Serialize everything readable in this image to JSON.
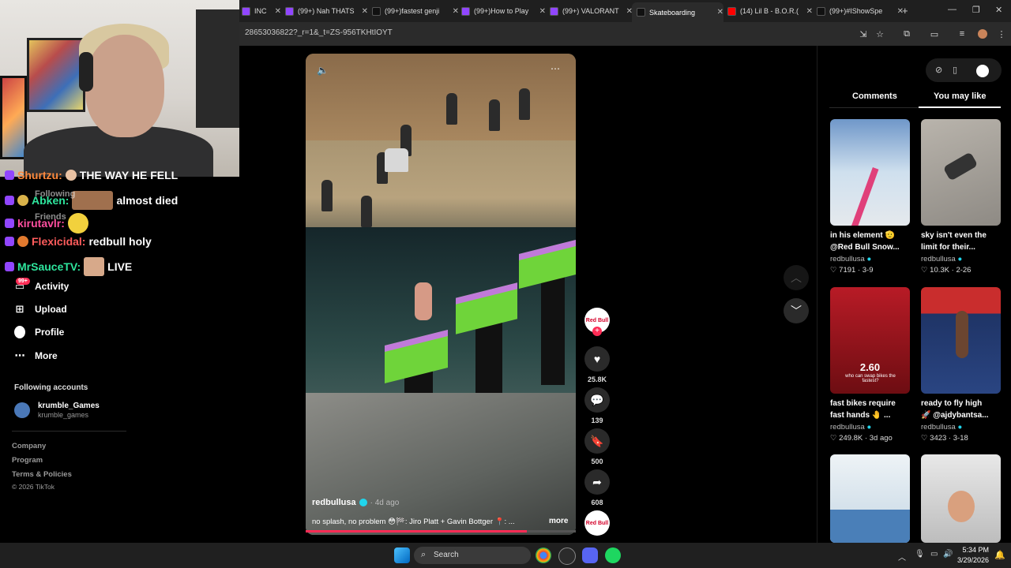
{
  "browser": {
    "tabs": [
      {
        "label": "INC",
        "icon": "twitch-icon",
        "color": "#9146ff"
      },
      {
        "label": "(99+) Nah THATS",
        "icon": "twitch-icon",
        "color": "#9146ff"
      },
      {
        "label": "(99+)fastest genji",
        "icon": "tiktok-icon",
        "color": "#000000"
      },
      {
        "label": "(99+)How to Play",
        "icon": "twitch-icon",
        "color": "#9146ff"
      },
      {
        "label": "(99+) VALORANT",
        "icon": "twitch-icon",
        "color": "#9146ff"
      },
      {
        "label": "Skateboarding",
        "icon": "tiktok-icon",
        "color": "#000000"
      },
      {
        "label": "(14) Lil B - B.O.R.(",
        "icon": "youtube-icon",
        "color": "#ff0000"
      },
      {
        "label": "(99+)#IShowSpe",
        "icon": "tiktok-icon",
        "color": "#000000"
      }
    ],
    "url": "28653036822?_r=1&_t=ZS-956TKHtIOYT"
  },
  "chat": [
    {
      "user": "Shurtzu:",
      "message": "THE WAY HE FELL",
      "color": "#ff8a3d"
    },
    {
      "user": "Abken:",
      "message": "almost died",
      "color": "#2ee59d"
    },
    {
      "user": "kirutavlr:",
      "message": "",
      "color": "#ff4fa0"
    },
    {
      "user": "Flexicidal:",
      "message": "redbull holy",
      "color": "#ff5c5c"
    },
    {
      "user": "MrSauceTV:",
      "message": "LIVE",
      "color": "#2ee59d"
    }
  ],
  "sidebar": {
    "hidden_items": [
      "Following",
      "Friends"
    ],
    "activity_badge": "99+",
    "nav": [
      {
        "label": "Activity",
        "icon": "inbox-icon"
      },
      {
        "label": "Upload",
        "icon": "plus-square-icon"
      },
      {
        "label": "Profile",
        "icon": "avatar-icon"
      },
      {
        "label": "More",
        "icon": "ellipsis-icon"
      }
    ],
    "following_header": "Following accounts",
    "following": [
      {
        "name": "krumble_Games",
        "handle": "krumble_games"
      }
    ],
    "footer": [
      "Company",
      "Program",
      "Terms & Policies",
      "© 2026 TikTok"
    ]
  },
  "video": {
    "author": "redbullusa",
    "age": "· 4d ago",
    "caption": "no splash, no problem 😳🏁: Jiro Platt + Gavin Bottger 📍: ...",
    "more": "more",
    "progress": 0.82,
    "actions": [
      {
        "name": "like",
        "icon": "heart-icon",
        "count": "25.8K"
      },
      {
        "name": "comment",
        "icon": "comment-icon",
        "count": "139"
      },
      {
        "name": "save",
        "icon": "bookmark-icon",
        "count": "500"
      },
      {
        "name": "share",
        "icon": "share-icon",
        "count": "608"
      }
    ],
    "logo_text": "Red Bull"
  },
  "panel": {
    "tabs": [
      "Comments",
      "You may like"
    ],
    "active_tab": "You may like",
    "cards": [
      {
        "title1": "in his element 🫡",
        "title2": "@Red Bull Snow...",
        "author": "redbullusa",
        "likes": "7191",
        "date": "3-9",
        "thumb": "#8fb3d9"
      },
      {
        "title1": "sky isn't even the",
        "title2": "limit for their...",
        "author": "redbullusa",
        "likes": "10.3K",
        "date": "2-26",
        "thumb": "#a9a39b"
      },
      {
        "title1": "fast bikes require",
        "title2": "fast hands 🤚 ...",
        "author": "redbullusa",
        "likes": "249.8K",
        "date": "3d ago",
        "thumb": "#c9202a",
        "overlay": "2.60",
        "overlay_sub": "who can swap bikes the fastest?"
      },
      {
        "title1": "ready to fly high",
        "title2": "🚀 @ajdybantsa...",
        "author": "redbullusa",
        "likes": "3423",
        "date": "3-18",
        "thumb": "#2a3e6b"
      },
      {
        "title1": "",
        "title2": "",
        "author": "",
        "likes": "",
        "date": "",
        "thumb": "#d8e6ef"
      },
      {
        "title1": "",
        "title2": "",
        "author": "",
        "likes": "",
        "date": "",
        "thumb": "#cfcfcf"
      }
    ]
  },
  "taskbar": {
    "search_placeholder": "Search",
    "time": "5:34 PM",
    "date": "3/29/2026"
  }
}
